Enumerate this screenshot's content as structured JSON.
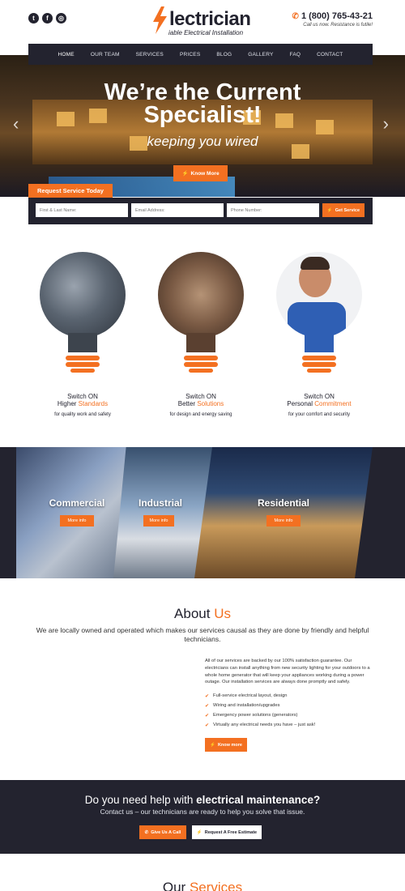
{
  "header": {
    "social": [
      {
        "icon": "twitter-icon",
        "glyph": "t"
      },
      {
        "icon": "facebook-icon",
        "glyph": "f"
      },
      {
        "icon": "instagram-icon",
        "glyph": "◎"
      }
    ],
    "logo_word": "lectrician",
    "logo_tag": "iable Electrical Installation",
    "phone": "1 (800) 765-43-21",
    "phone_tag": "Call us now. Resistance is futile!"
  },
  "nav": [
    "HOME",
    "OUR TEAM",
    "SERVICES",
    "PRICES",
    "BLOG",
    "GALLERY",
    "FAQ",
    "CONTACT"
  ],
  "hero": {
    "title_line1": "We’re the Current",
    "title_line2": "Specialist!",
    "subtitle": "keeping you wired",
    "button": "Know More"
  },
  "request": {
    "tab": "Request Service Today",
    "name_placeholder": "First & Last Name:",
    "email_placeholder": "Email Address:",
    "phone_placeholder": "Phone Number:",
    "button": "Get Service"
  },
  "features": [
    {
      "t1": "Switch ON",
      "t2a": "Higher ",
      "t2b": "Standards",
      "t3": "for quality work and safety"
    },
    {
      "t1": "Switch ON",
      "t2a": "Better ",
      "t2b": "Solutions",
      "t3": "for design and energy saving"
    },
    {
      "t1": "Switch ON",
      "t2a": "Personal ",
      "t2b": "Commitment",
      "t3": "for your comfort and security"
    }
  ],
  "categories": [
    {
      "title": "Commercial",
      "button": "More info"
    },
    {
      "title": "Industrial",
      "button": "More info"
    },
    {
      "title": "Residential",
      "button": "More info"
    }
  ],
  "about": {
    "title_a": "About ",
    "title_b": "Us",
    "lead": "We are locally owned and operated which makes our services causal as they are done by friendly and helpful technicians.",
    "paragraph": "All of our services are backed by our 100% satisfaction guarantee. Our electricians can install anything from new security lighting for your outdoors to a whole home generator that will keep your appliances working during a power outage. Our installation services are always done promptly and safely.",
    "list": [
      "Full-service electrical layout, design",
      "Wiring and installation/upgrades",
      "Emergency power solutions (generators)",
      "Virtually any electrical needs you have – just ask!"
    ],
    "button": "Know more"
  },
  "cta": {
    "title_a": "Do you need help with ",
    "title_b": "electrical maintenance?",
    "subtitle": "Contact us – our technicians are ready to help you solve that issue.",
    "button1": "Give Us A Call",
    "button2": "Request A Free Estimate"
  },
  "services": {
    "title_a": "Our ",
    "title_b": "Services"
  },
  "colors": {
    "accent": "#f37021",
    "dark": "#23232f"
  }
}
